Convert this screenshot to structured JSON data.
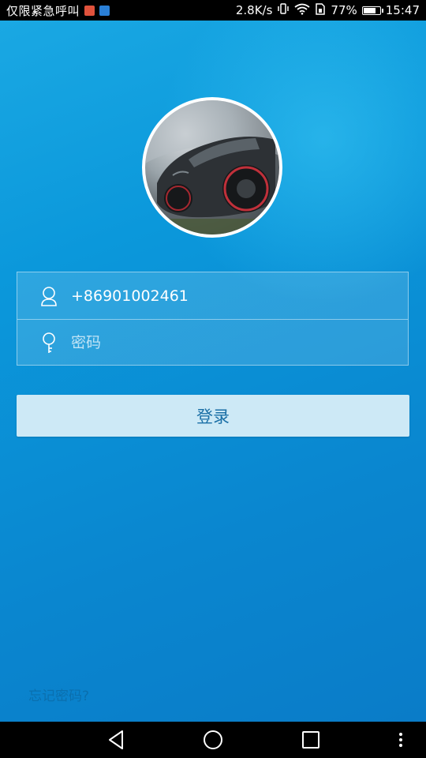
{
  "status_bar": {
    "carrier": "仅限紧急呼叫",
    "net_speed": "2.8K/s",
    "battery_pct": "77%",
    "battery_level": 0.77,
    "time": "15:47",
    "icons": [
      "notification-app-icon",
      "notification-app-icon",
      "vibrate-icon",
      "wifi-icon",
      "sim-icon",
      "battery-icon"
    ]
  },
  "login": {
    "phone": "+86901002461",
    "password_placeholder": "密码",
    "login_label": "登录",
    "forgot_label": "忘记密码?"
  },
  "colors": {
    "background": "#0b98db",
    "button_bg": "#cde9f6",
    "button_text": "#1a6fa6",
    "forgot_text": "#0a6fae"
  },
  "nav_bar": {
    "buttons": [
      "back-icon",
      "home-icon",
      "recents-icon",
      "menu-icon"
    ]
  }
}
